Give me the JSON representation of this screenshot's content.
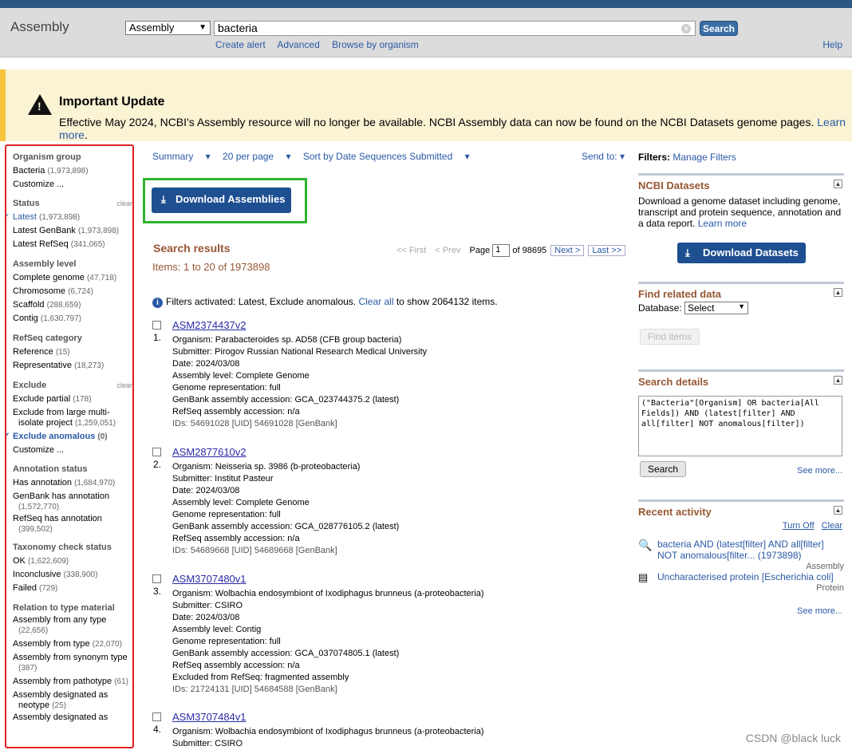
{
  "header": {
    "brand": "Assembly",
    "db_select": "Assembly",
    "search_term": "bacteria",
    "search_button": "Search",
    "links": [
      "Create alert",
      "Advanced",
      "Browse by organism"
    ],
    "help": "Help"
  },
  "banner": {
    "title": "Important Update",
    "text": "Effective May 2024, NCBI's Assembly resource will no longer be available. NCBI Assembly data can now be found on the NCBI Datasets genome pages.",
    "link": "Learn more",
    "suffix": "."
  },
  "sidebar": {
    "clear": "clear",
    "groups": [
      {
        "title": "Organism group",
        "items": [
          {
            "label": "Bacteria",
            "count": "(1,973,898)"
          },
          {
            "label": "Customize ...",
            "count": ""
          }
        ]
      },
      {
        "title": "Status",
        "items": [
          {
            "label": "Latest",
            "count": "(1,973,898)"
          },
          {
            "label": "Latest GenBank",
            "count": "(1,973,898)"
          },
          {
            "label": "Latest RefSeq",
            "count": "(341,065)"
          }
        ]
      },
      {
        "title": "Assembly level",
        "items": [
          {
            "label": "Complete genome",
            "count": "(47,718)"
          },
          {
            "label": "Chromosome",
            "count": "(6,724)"
          },
          {
            "label": "Scaffold",
            "count": "(288,659)"
          },
          {
            "label": "Contig",
            "count": "(1,630,797)"
          }
        ]
      },
      {
        "title": "RefSeq category",
        "items": [
          {
            "label": "Reference",
            "count": "(15)"
          },
          {
            "label": "Representative",
            "count": "(18,273)"
          }
        ]
      },
      {
        "title": "Exclude",
        "items": [
          {
            "label": "Exclude partial",
            "count": "(178)"
          },
          {
            "label": "Exclude from large multi-isolate project",
            "count": "(1,259,051)"
          },
          {
            "label": "Exclude anomalous",
            "count": "(0)"
          },
          {
            "label": "Customize ...",
            "count": ""
          }
        ]
      },
      {
        "title": "Annotation status",
        "items": [
          {
            "label": "Has annotation",
            "count": "(1,684,970)"
          },
          {
            "label": "GenBank has annotation",
            "count": "(1,572,770)"
          },
          {
            "label": "RefSeq has annotation",
            "count": "(399,502)"
          }
        ]
      },
      {
        "title": "Taxonomy check status",
        "items": [
          {
            "label": "OK",
            "count": "(1,622,609)"
          },
          {
            "label": "Inconclusive",
            "count": "(338,900)"
          },
          {
            "label": "Failed",
            "count": "(729)"
          }
        ]
      },
      {
        "title": "Relation to type material",
        "items": [
          {
            "label": "Assembly from any type",
            "count": "(22,656)"
          },
          {
            "label": "Assembly from type",
            "count": "(22,070)"
          },
          {
            "label": "Assembly from synonym type",
            "count": "(387)"
          },
          {
            "label": "Assembly from pathotype",
            "count": "(61)"
          },
          {
            "label": "Assembly designated as neotype",
            "count": "(25)"
          },
          {
            "label": "Assembly designated as",
            "count": ""
          }
        ]
      }
    ]
  },
  "toolbar": {
    "summary": "Summary",
    "per_page": "20 per page",
    "sort": "Sort by Date Sequences Submitted",
    "send_to": "Send to:"
  },
  "download_button": "Download Assemblies",
  "results_header": {
    "title": "Search results",
    "items": "Items: 1 to 20 of 1973898"
  },
  "pager": {
    "first": "<< First",
    "prev": "< Prev",
    "page_label": "Page",
    "page": "1",
    "of": "of 98695",
    "next": "Next >",
    "last": "Last >>"
  },
  "filters_info": {
    "text": "Filters activated: Latest, Exclude anomalous.",
    "link": "Clear all",
    "suffix": "to show 2064132 items."
  },
  "results": [
    {
      "num": "1.",
      "title": "ASM2374437v2",
      "lines": [
        "Organism: Parabacteroides sp. AD58 (CFB group bacteria)",
        "Submitter: Pirogov Russian National Research Medical University",
        "Date: 2024/03/08",
        "Assembly level: Complete Genome",
        "Genome representation: full",
        "GenBank assembly accession: GCA_023744375.2 (latest)",
        "RefSeq assembly accession: n/a"
      ],
      "ids": "IDs: 54691028 [UID] 54691028 [GenBank]"
    },
    {
      "num": "2.",
      "title": "ASM2877610v2",
      "lines": [
        "Organism: Neisseria sp. 3986 (b-proteobacteria)",
        "Submitter: Institut Pasteur",
        "Date: 2024/03/08",
        "Assembly level: Complete Genome",
        "Genome representation: full",
        "GenBank assembly accession: GCA_028776105.2 (latest)",
        "RefSeq assembly accession: n/a"
      ],
      "ids": "IDs: 54689668 [UID] 54689668 [GenBank]"
    },
    {
      "num": "3.",
      "title": "ASM3707480v1",
      "lines": [
        "Organism: Wolbachia endosymbiont of Ixodiphagus brunneus (a-proteobacteria)",
        "Submitter: CSIRO",
        "Date: 2024/03/08",
        "Assembly level: Contig",
        "Genome representation: full",
        "GenBank assembly accession: GCA_037074805.1 (latest)",
        "RefSeq assembly accession: n/a",
        "Excluded from RefSeq: fragmented assembly"
      ],
      "ids": "IDs: 21724131 [UID] 54684588 [GenBank]"
    },
    {
      "num": "4.",
      "title": "ASM3707484v1",
      "lines": [
        "Organism: Wolbachia endosymbiont of Ixodiphagus brunneus (a-proteobacteria)",
        "Submitter: CSIRO"
      ],
      "ids": ""
    }
  ],
  "right": {
    "filters_label": "Filters:",
    "manage_filters": "Manage Filters",
    "datasets": {
      "title": "NCBI Datasets",
      "text": "Download a genome dataset including genome, transcript and protein sequence, annotation and a data report.",
      "link": "Learn more",
      "button": "Download Datasets"
    },
    "related": {
      "title": "Find related data",
      "db_label": "Database:",
      "db_value": "Select",
      "button": "Find items"
    },
    "details": {
      "title": "Search details",
      "query": "(\"Bacteria\"[Organism] OR bacteria[All Fields]) AND (latest[filter] AND all[filter] NOT anomalous[filter])",
      "button": "Search",
      "see_more": "See more..."
    },
    "recent": {
      "title": "Recent activity",
      "turn_off": "Turn Off",
      "clear": "Clear",
      "items": [
        {
          "text": "bacteria AND (latest[filter] AND all[filter] NOT anomalous[filter... (1973898)",
          "tag": "Assembly"
        },
        {
          "text": "Uncharacterised protein [Escherichia coli]",
          "tag": "Protein"
        }
      ],
      "see_more": "See more..."
    }
  },
  "watermark": "CSDN @black luck"
}
